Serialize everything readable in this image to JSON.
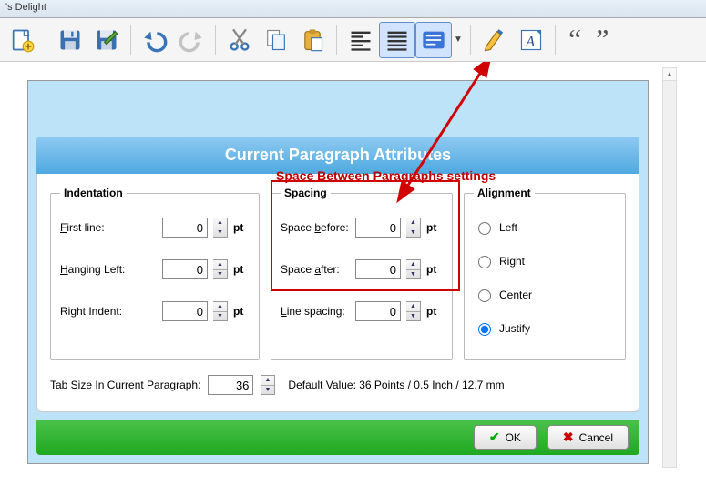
{
  "window": {
    "title_fragment": "'s Delight"
  },
  "toolbar": {
    "icons": [
      "new",
      "save",
      "save-doc",
      "undo",
      "redo",
      "cut",
      "copy",
      "paste",
      "align-left",
      "align-justify",
      "paragraph-settings",
      "edit",
      "font",
      "open-quote",
      "close-quote"
    ]
  },
  "dialog": {
    "title": "Current Paragraph Attributes",
    "annotation": "Space Between Paragraphs settings",
    "indent": {
      "legend": "Indentation",
      "first_line_label": "irst line:",
      "first_line_accel": "F",
      "first_line_value": "0",
      "hanging_label": "anging Left:",
      "hanging_accel": "H",
      "hanging_value": "0",
      "right_label": "Right Indent:",
      "right_value": "0",
      "unit": "pt"
    },
    "spacing": {
      "legend": "Spacing",
      "before_label_pre": "Space ",
      "before_label_accel": "b",
      "before_label_post": "efore:",
      "before_value": "0",
      "after_label_pre": "Space ",
      "after_label_accel": "a",
      "after_label_post": "fter:",
      "after_value": "0",
      "line_label_accel": "L",
      "line_label_post": "ine spacing:",
      "line_value": "0",
      "unit": "pt"
    },
    "align": {
      "legend": "Alignment",
      "left": "Left",
      "right": "Right",
      "center": "Center",
      "justify": "Justify",
      "selected": "justify"
    },
    "tab": {
      "label": "Tab Size In Current Paragraph:",
      "value": "36",
      "hint": "Default Value: 36 Points / 0.5 Inch / 12.7 mm"
    },
    "buttons": {
      "ok": "OK",
      "cancel": "Cancel"
    }
  }
}
